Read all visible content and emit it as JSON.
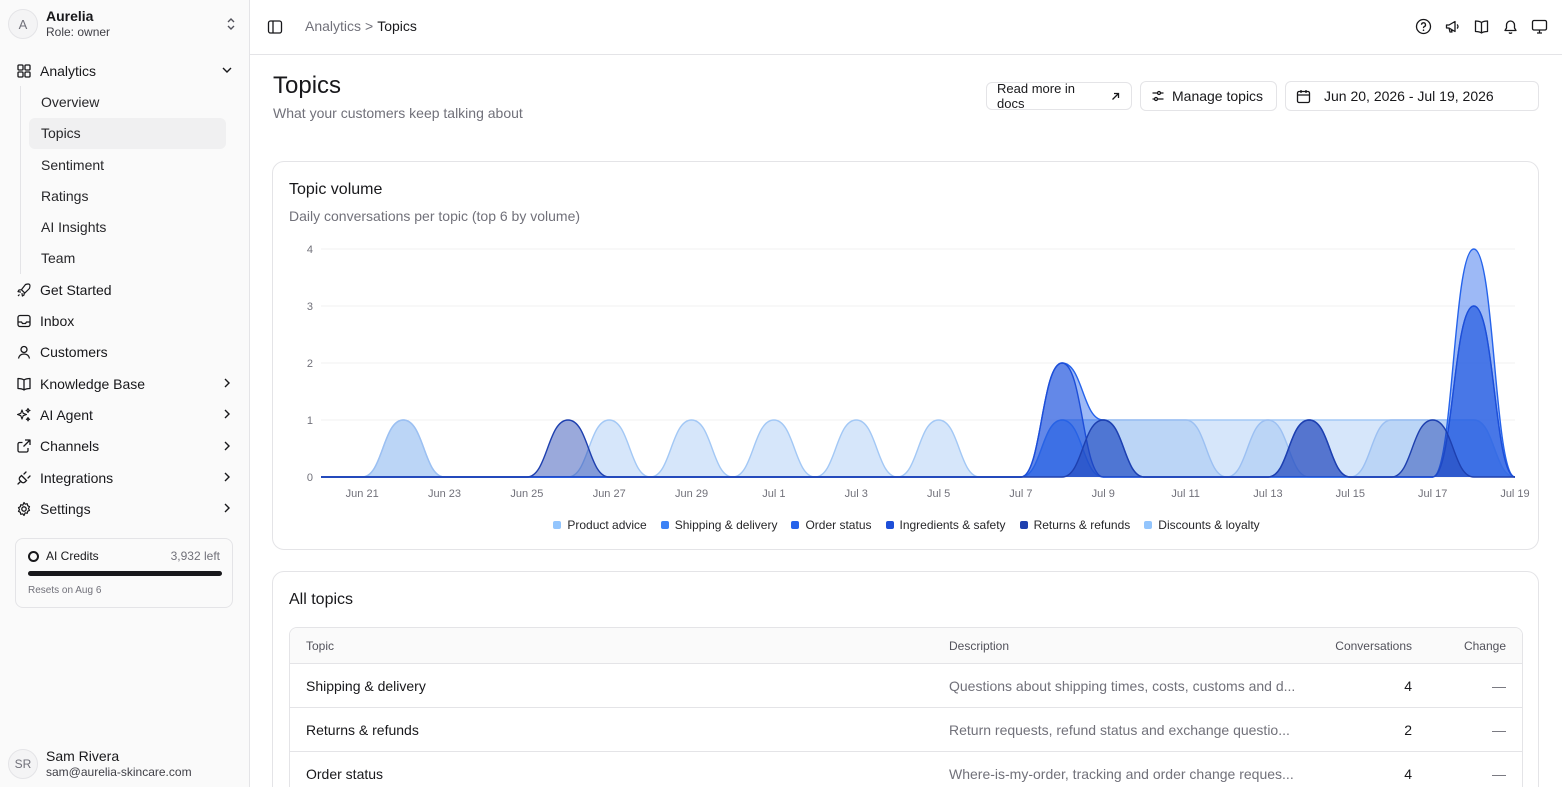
{
  "org": {
    "initial": "A",
    "name": "Aurelia",
    "role": "Role: owner"
  },
  "nav": {
    "analytics": "Analytics",
    "analytics_sub": [
      "Overview",
      "Topics",
      "Sentiment",
      "Ratings",
      "AI Insights",
      "Team"
    ],
    "active_sub": "Topics",
    "items": [
      "Get Started",
      "Inbox",
      "Customers",
      "Knowledge Base",
      "AI Agent",
      "Channels",
      "Integrations",
      "Settings"
    ]
  },
  "credits": {
    "title": "AI Credits",
    "left": "3,932 left",
    "reset": "Resets on Aug 6",
    "fill_fraction": 1.0
  },
  "user": {
    "initials": "SR",
    "name": "Sam Rivera",
    "email": "sam@aurelia-skincare.com"
  },
  "breadcrumb": {
    "parent": "Analytics",
    "separator": ">",
    "current": "Topics"
  },
  "top_icons": [
    "help-icon",
    "megaphone-icon",
    "book-icon",
    "bell-icon",
    "monitor-icon"
  ],
  "header": {
    "title": "Topics",
    "subtitle": "What your customers keep talking about",
    "docs_button": "Read more in docs",
    "manage_button": "Manage topics",
    "date_range": "Jun 20, 2026 - Jul 19, 2026"
  },
  "chart_card": {
    "title": "Topic volume",
    "subtitle": "Daily conversations per topic (top 6 by volume)"
  },
  "chart_data": {
    "type": "area",
    "x_ticks": [
      "Jun 21",
      "Jun 23",
      "Jun 25",
      "Jun 27",
      "Jun 29",
      "Jul 1",
      "Jul 3",
      "Jul 5",
      "Jul 7",
      "Jul 9",
      "Jul 11",
      "Jul 13",
      "Jul 15",
      "Jul 17",
      "Jul 19"
    ],
    "y_ticks": [
      0,
      1,
      2,
      3,
      4
    ],
    "ylim": [
      0,
      4
    ],
    "grid": true,
    "legend_position": "bottom",
    "x_count": 30,
    "series": [
      {
        "name": "Discounts & loyalty",
        "color": "#a3c8f5",
        "values": [
          0,
          0,
          1,
          0,
          0,
          0,
          0,
          1,
          0,
          1,
          0,
          1,
          0,
          1,
          0,
          1,
          0,
          0,
          1,
          1,
          1,
          1,
          1,
          1,
          1,
          1,
          1,
          1,
          1,
          0
        ]
      },
      {
        "name": "Product advice",
        "color": "#9cc0f2",
        "values": [
          0,
          0,
          1,
          0,
          0,
          0,
          0,
          0,
          0,
          0,
          0,
          0,
          0,
          0,
          0,
          0,
          0,
          0,
          1,
          1,
          1,
          1,
          0,
          1,
          0,
          0,
          1,
          1,
          1,
          0
        ]
      },
      {
        "name": "Shipping & delivery",
        "color": "#3b82f6",
        "values": [
          0,
          0,
          0,
          0,
          0,
          0,
          0,
          0,
          0,
          0,
          0,
          0,
          0,
          0,
          0,
          0,
          0,
          0,
          1,
          0,
          0,
          0,
          0,
          0,
          0,
          0,
          0,
          0,
          3,
          0
        ]
      },
      {
        "name": "Order status",
        "color": "#2563eb",
        "values": [
          0,
          0,
          0,
          0,
          0,
          0,
          0,
          0,
          0,
          0,
          0,
          0,
          0,
          0,
          0,
          0,
          0,
          0,
          2,
          1,
          0,
          0,
          0,
          0,
          0,
          0,
          0,
          0,
          4,
          0
        ]
      },
      {
        "name": "Ingredients & safety",
        "color": "#1d4ed8",
        "values": [
          0,
          0,
          0,
          0,
          0,
          0,
          0,
          0,
          0,
          0,
          0,
          0,
          0,
          0,
          0,
          0,
          0,
          0,
          2,
          0,
          0,
          0,
          0,
          0,
          1,
          0,
          0,
          0,
          3,
          0
        ]
      },
      {
        "name": "Returns & refunds",
        "color": "#1e40af",
        "values": [
          0,
          0,
          0,
          0,
          0,
          0,
          1,
          0,
          0,
          0,
          0,
          0,
          0,
          0,
          0,
          0,
          0,
          0,
          0,
          1,
          0,
          0,
          0,
          0,
          1,
          0,
          0,
          1,
          0,
          0
        ]
      }
    ],
    "legend": [
      {
        "name": "Product advice",
        "color": "#93c5fd"
      },
      {
        "name": "Shipping & delivery",
        "color": "#3b82f6"
      },
      {
        "name": "Order status",
        "color": "#2563eb"
      },
      {
        "name": "Ingredients & safety",
        "color": "#1d4ed8"
      },
      {
        "name": "Returns & refunds",
        "color": "#1e40af"
      },
      {
        "name": "Discounts & loyalty",
        "color": "#93c5fd"
      }
    ]
  },
  "table": {
    "title": "All topics",
    "columns": {
      "topic": "Topic",
      "description": "Description",
      "conversations": "Conversations",
      "change": "Change"
    },
    "rows": [
      {
        "topic": "Shipping & delivery",
        "description": "Questions about shipping times, costs, customs and d...",
        "conversations": "4",
        "change": "—"
      },
      {
        "topic": "Returns & refunds",
        "description": "Return requests, refund status and exchange questio...",
        "conversations": "2",
        "change": "—"
      },
      {
        "topic": "Order status",
        "description": "Where-is-my-order, tracking and order change reques...",
        "conversations": "4",
        "change": "—"
      }
    ]
  }
}
